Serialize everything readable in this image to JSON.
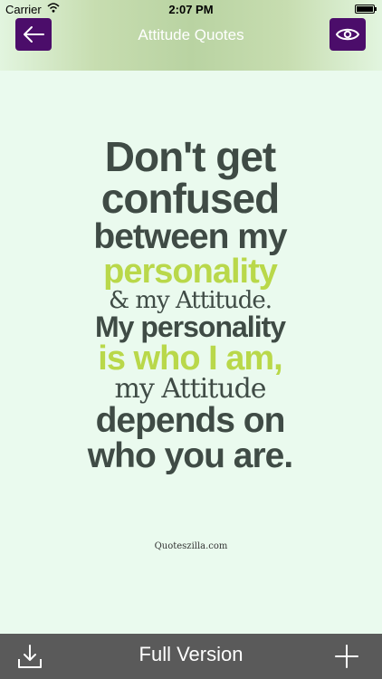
{
  "status_bar": {
    "carrier": "Carrier",
    "time": "2:07 PM"
  },
  "navbar": {
    "title": "Attitude Quotes",
    "back_icon": "arrow-left-icon",
    "preview_icon": "eye-icon",
    "button_color": "#4b0d6a"
  },
  "quote": {
    "lines": [
      "Don't get",
      "confused",
      "between my",
      "personality",
      "& my Attitude.",
      "My personality",
      "is who I am,",
      "my Attitude",
      "depends on",
      "who you are."
    ],
    "credit": "Quoteszilla.com",
    "text_color": "#3f4b45",
    "highlight_color": "#b9d84a"
  },
  "bottom_bar": {
    "title": "Full Version",
    "download_icon": "download-icon",
    "add_icon": "plus-icon",
    "background": "#5a5a5a"
  }
}
